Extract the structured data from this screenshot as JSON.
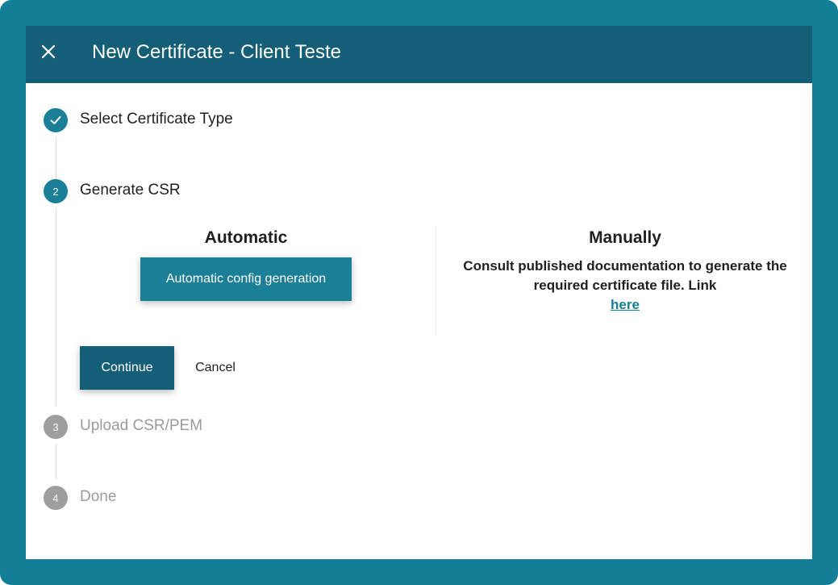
{
  "dialog": {
    "title": "New Certificate - Client Teste",
    "close_icon": "close-icon"
  },
  "steps": [
    {
      "number": "1",
      "label": "Select Certificate Type",
      "state": "completed",
      "icon": "checkmark-icon"
    },
    {
      "number": "2",
      "label": "Generate CSR",
      "state": "active"
    },
    {
      "number": "3",
      "label": "Upload CSR/PEM",
      "state": "pending"
    },
    {
      "number": "4",
      "label": "Done",
      "state": "pending"
    }
  ],
  "generate_csr": {
    "automatic": {
      "title": "Automatic",
      "button_label": "Automatic config generation"
    },
    "manual": {
      "title": "Manually",
      "text": "Consult published documentation to generate the required certificate file. Link",
      "link_label": "here"
    }
  },
  "actions": {
    "continue_label": "Continue",
    "cancel_label": "Cancel"
  },
  "colors": {
    "frame": "#137f96",
    "header": "#155e78",
    "accent": "#1b7f98",
    "pending": "#9e9e9e"
  }
}
